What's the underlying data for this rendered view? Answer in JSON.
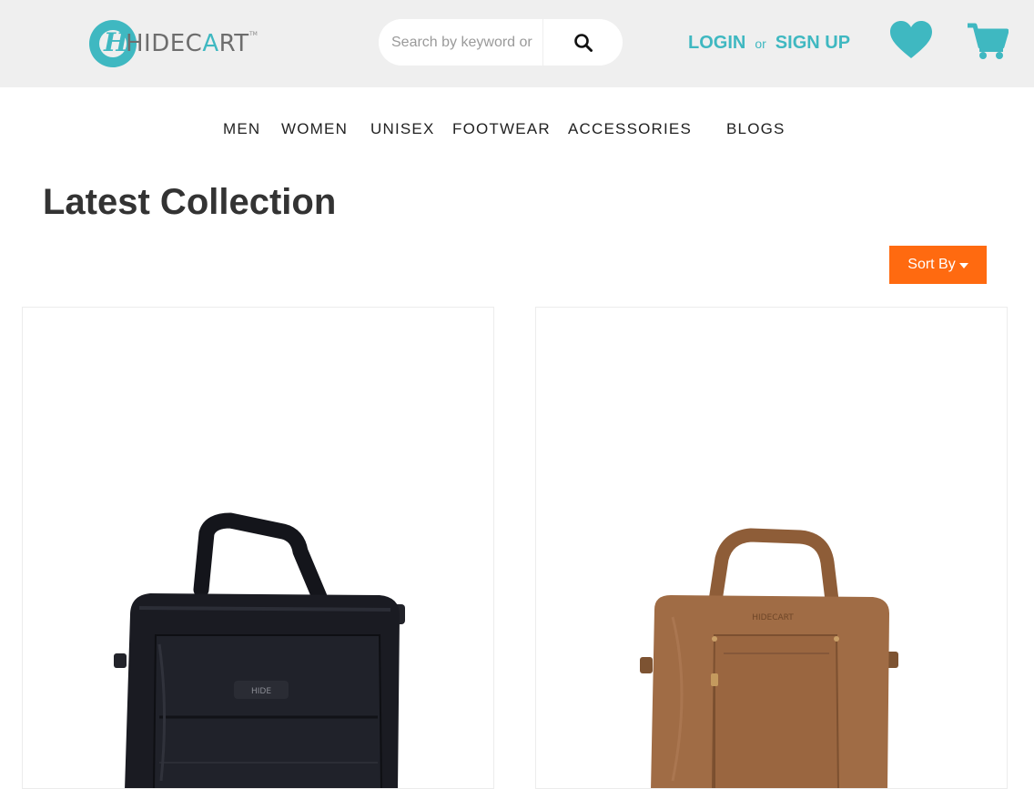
{
  "header": {
    "logo": {
      "mark": "H",
      "text_part1": "HIDEC",
      "text_part2": "A",
      "text_part3": "RT",
      "tm": "TM"
    },
    "search": {
      "placeholder": "Search by keyword or",
      "button_icon": "search-icon"
    },
    "auth": {
      "login": "LOGIN",
      "or": "or",
      "signup": "SIGN UP"
    },
    "icons": {
      "wishlist": "heart-icon",
      "cart": "cart-icon"
    },
    "accent_color": "#3fb8c1"
  },
  "nav": {
    "items": [
      "MEN",
      "WOMEN",
      "UNISEX",
      "FOOTWEAR",
      "ACCESSORIES",
      "BLOGS"
    ]
  },
  "main": {
    "title": "Latest Collection",
    "sort": {
      "label": "Sort By",
      "color": "#ff6a10"
    },
    "products": [
      {
        "image": "black-leather-laptop-bag",
        "color": "#1a1b22"
      },
      {
        "image": "tan-leather-laptop-bag",
        "color": "#a06c45"
      }
    ]
  }
}
